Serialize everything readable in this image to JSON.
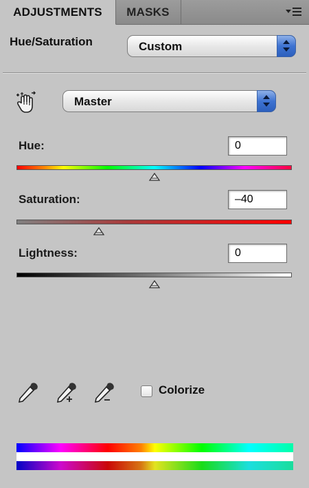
{
  "tabs": [
    {
      "label": "ADJUSTMENTS",
      "active": true
    },
    {
      "label": "MASKS",
      "active": false
    }
  ],
  "panel": {
    "title": "Hue/Saturation",
    "preset": "Custom",
    "channel": "Master"
  },
  "sliders": {
    "hue": {
      "label": "Hue:",
      "value": "0",
      "level": 0.5
    },
    "saturation": {
      "label": "Saturation:",
      "value": "–40",
      "level": 0.3
    },
    "lightness": {
      "label": "Lightness:",
      "value": "0",
      "level": 0.5
    }
  },
  "tools": {
    "target_adjust_icon": "hand-target-icon",
    "eyedropper_icon": "eyedropper-icon",
    "eyedropper_add_icon": "eyedropper-plus-icon",
    "eyedropper_subtract_icon": "eyedropper-minus-icon"
  },
  "colorize": {
    "label": "Colorize",
    "checked": false
  },
  "colors": {
    "panel_bg": "#c5c5c5",
    "stepper_blue": "#3e73d2"
  }
}
